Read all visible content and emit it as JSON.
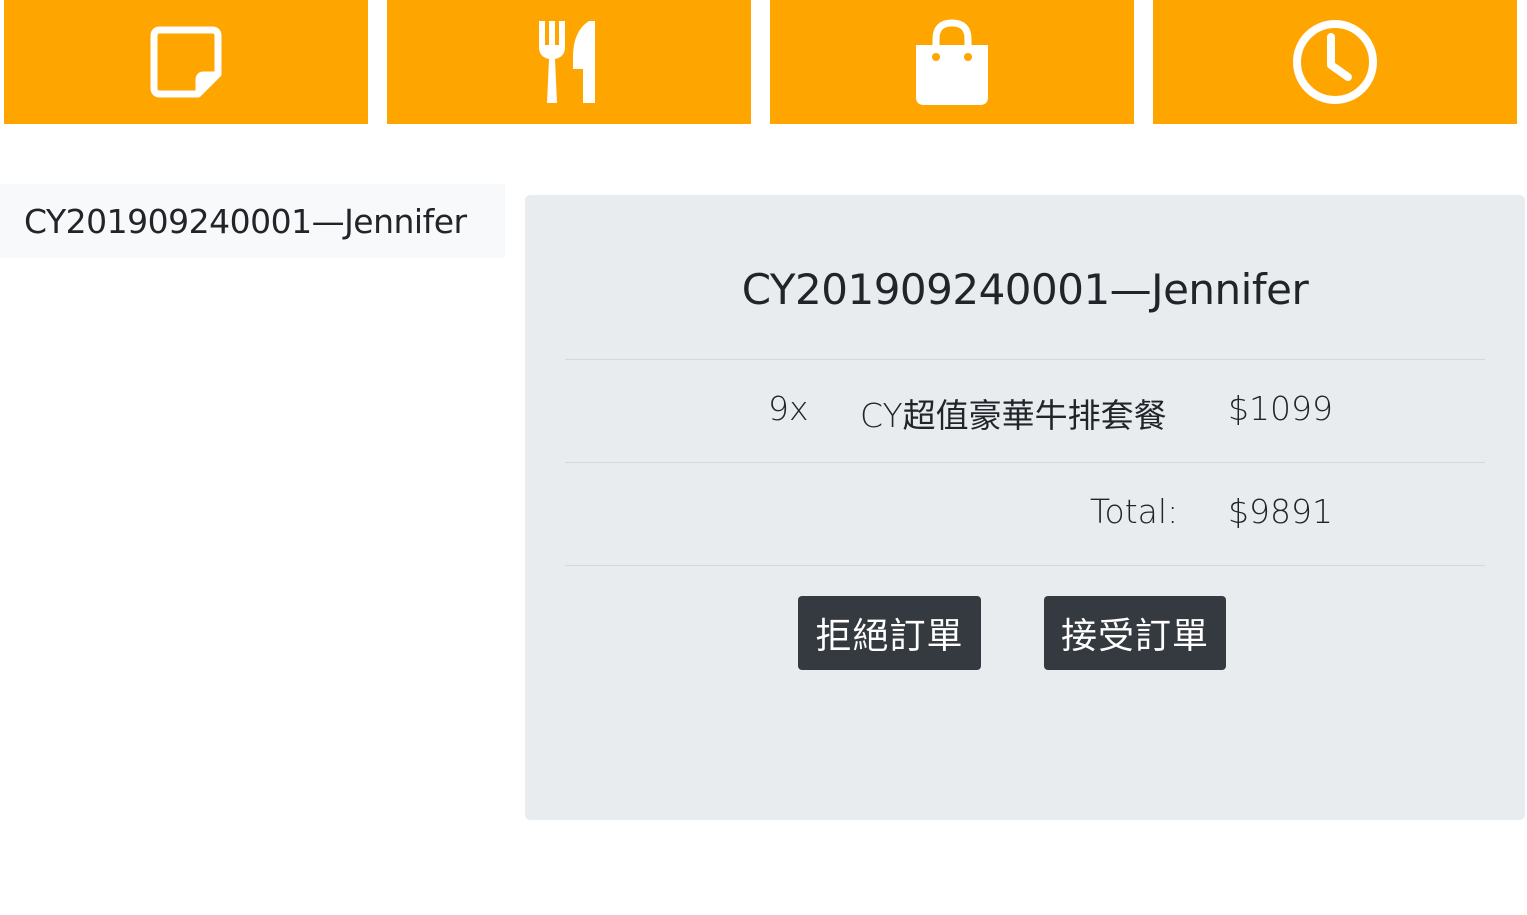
{
  "nav": {
    "tabs": [
      {
        "icon": "note-icon",
        "color": "#ffa500"
      },
      {
        "icon": "utensils-icon",
        "color": "#ffa500"
      },
      {
        "icon": "shopping-bag-icon",
        "color": "#ffa500"
      },
      {
        "icon": "clock-icon",
        "color": "#ffa500"
      }
    ]
  },
  "order_list": {
    "items": [
      {
        "label": "CY201909240001—Jennifer"
      }
    ]
  },
  "order_detail": {
    "title": "CY201909240001—Jennifer",
    "line_items": [
      {
        "quantity": "9x",
        "name": "CY超值豪華牛排套餐",
        "price": "$1099"
      }
    ],
    "total_label": "Total:",
    "total_value": "$9891",
    "reject_label": "拒絕訂單",
    "accept_label": "接受訂單"
  },
  "colors": {
    "nav_bg": "#ffa500",
    "panel_bg": "#e9ecef",
    "button_bg": "#343a40",
    "list_item_bg": "#f8f9fa"
  }
}
